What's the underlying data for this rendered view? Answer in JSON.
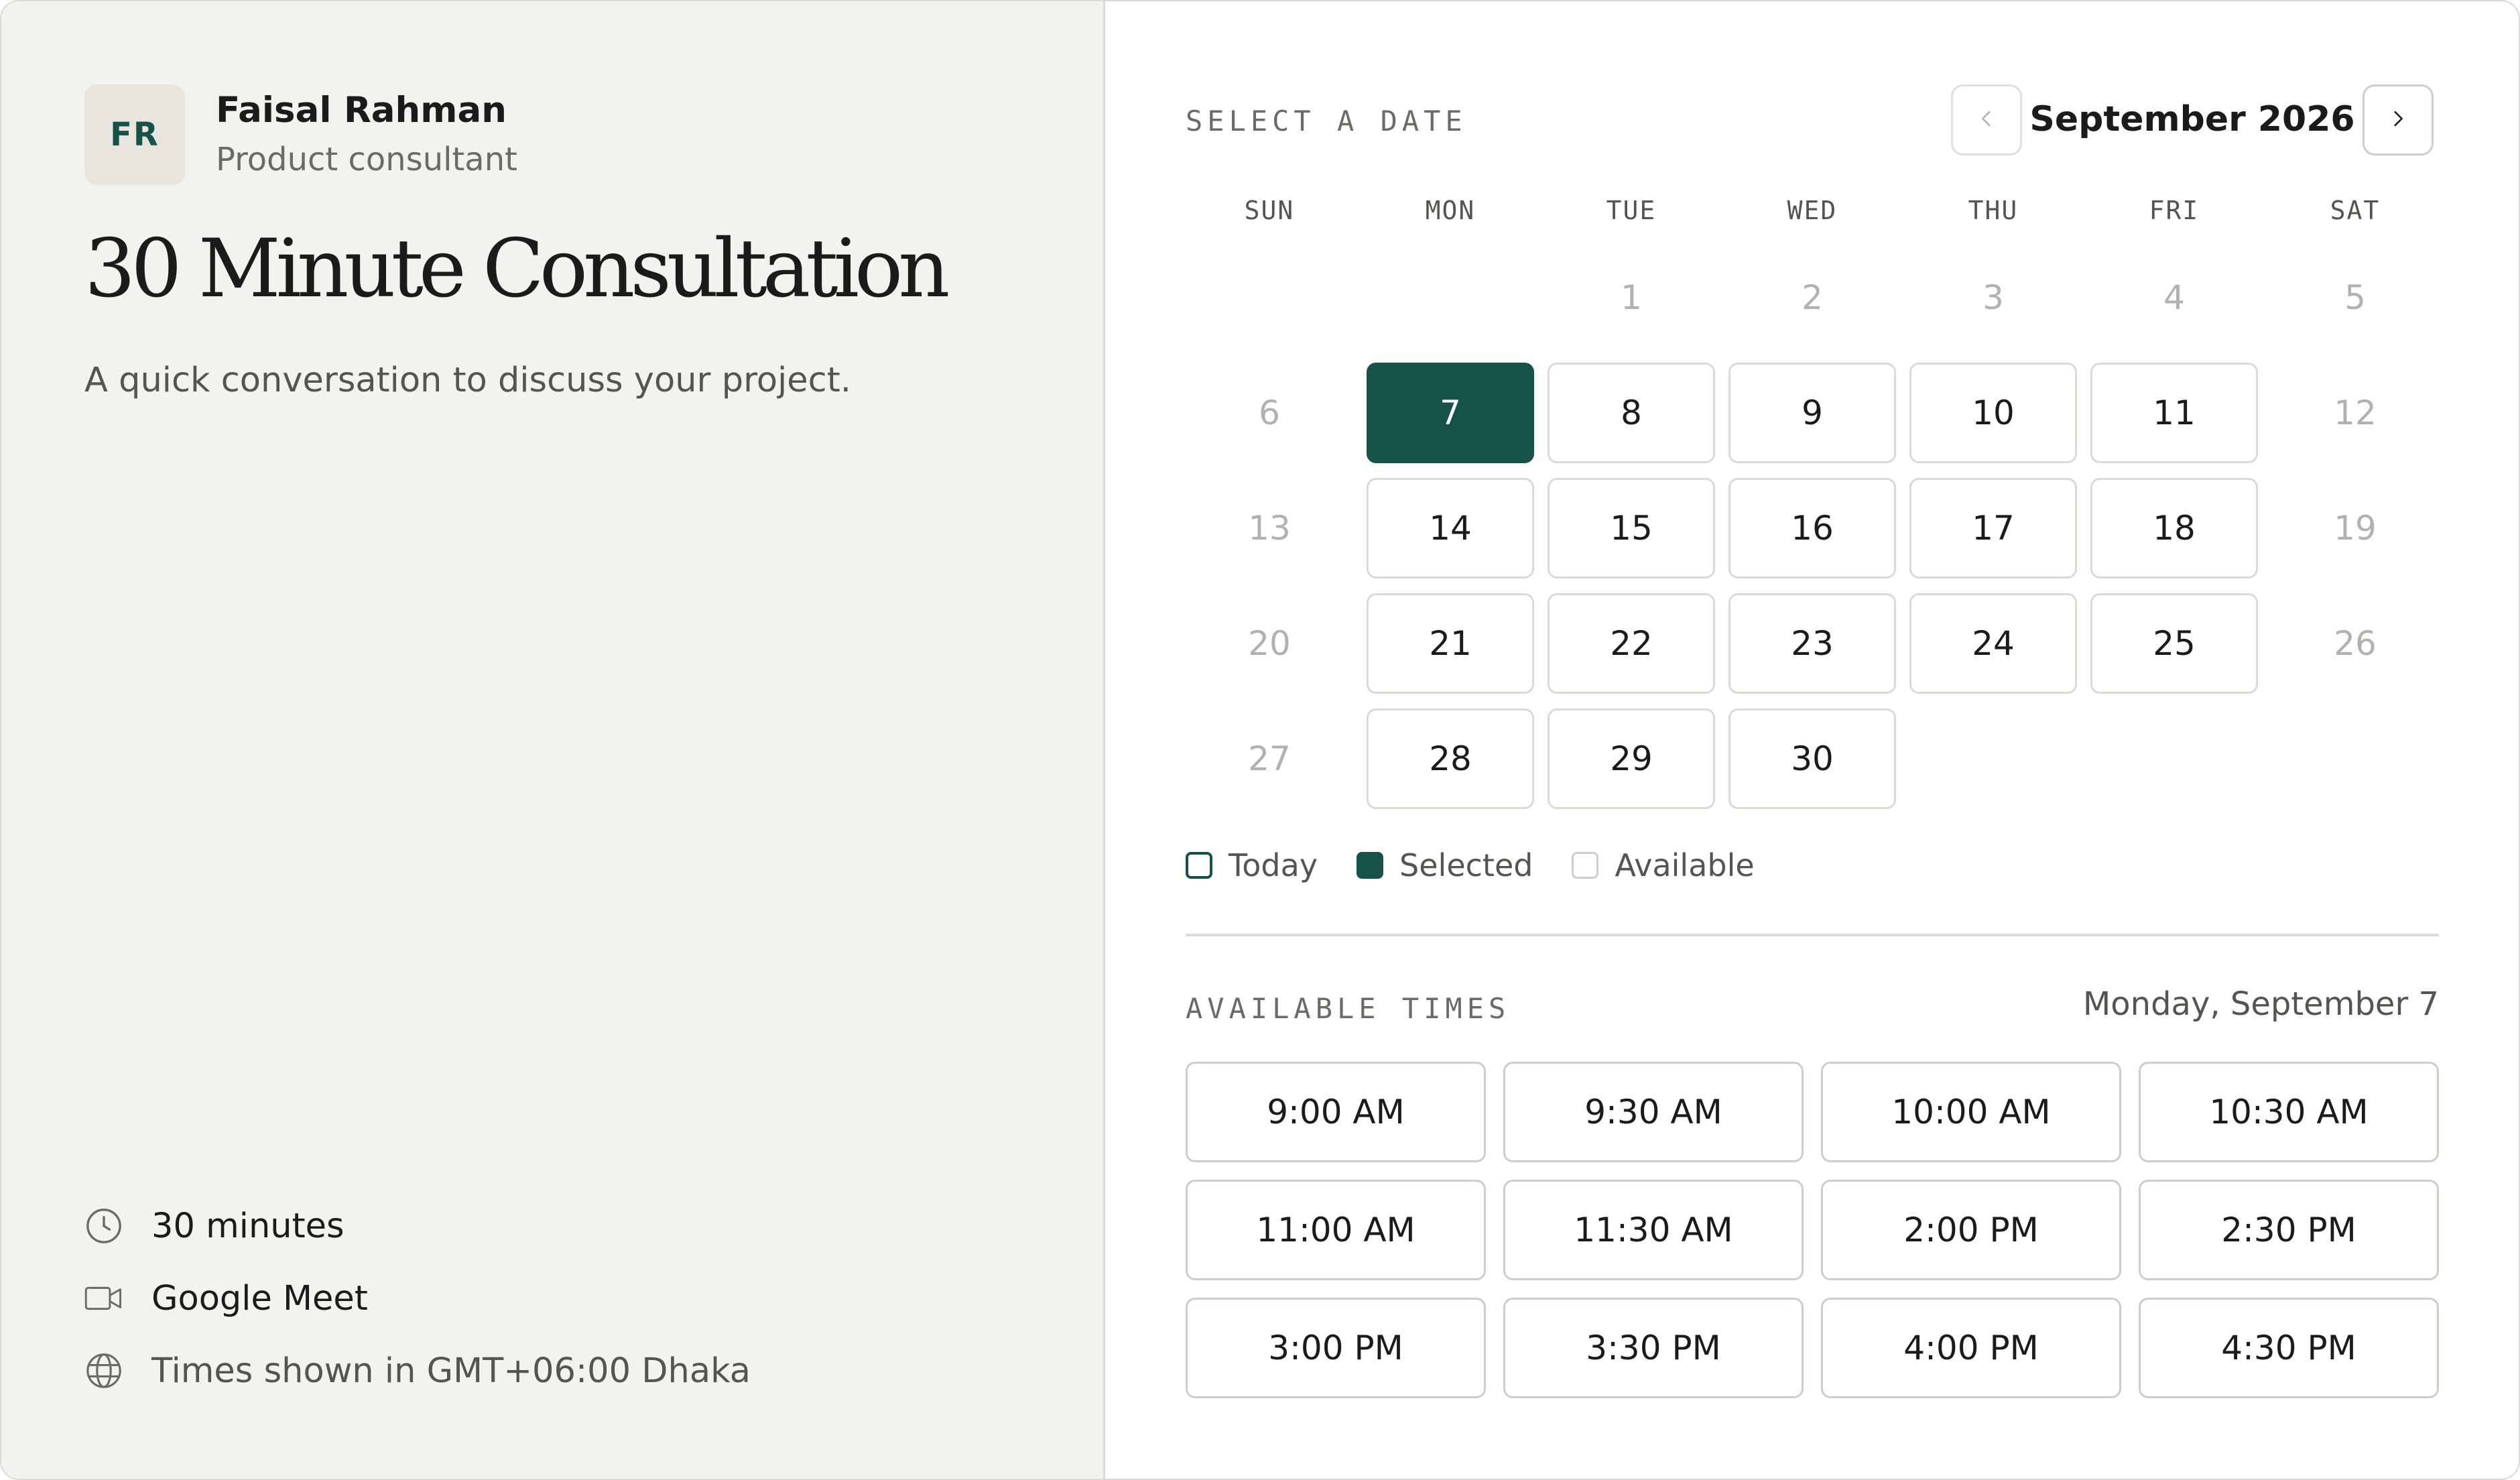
{
  "host": {
    "initials": "FR",
    "name": "Faisal Rahman",
    "role": "Product consultant"
  },
  "event": {
    "title": "30 Minute Consultation",
    "description": "A quick conversation to discuss your project."
  },
  "meta": {
    "duration": "30 minutes",
    "platform": "Google Meet",
    "timezone": "Times shown in GMT+06:00 Dhaka"
  },
  "calendar": {
    "section_label": "SELECT A DATE",
    "month": "September 2026",
    "prev_icon": "chevron-left-icon",
    "next_icon": "chevron-right-icon",
    "weekdays": [
      "SUN",
      "MON",
      "TUE",
      "WED",
      "THU",
      "FRI",
      "SAT"
    ],
    "days": [
      {
        "day": "1",
        "state": "unavailable"
      },
      {
        "day": "2",
        "state": "unavailable"
      },
      {
        "day": "3",
        "state": "unavailable"
      },
      {
        "day": "4",
        "state": "unavailable"
      },
      {
        "day": "5",
        "state": "unavailable"
      },
      {
        "day": "6",
        "state": "unavailable"
      },
      {
        "day": "7",
        "state": "selected"
      },
      {
        "day": "8",
        "state": "available"
      },
      {
        "day": "9",
        "state": "available"
      },
      {
        "day": "10",
        "state": "available"
      },
      {
        "day": "11",
        "state": "available"
      },
      {
        "day": "12",
        "state": "unavailable"
      },
      {
        "day": "13",
        "state": "unavailable"
      },
      {
        "day": "14",
        "state": "available"
      },
      {
        "day": "15",
        "state": "available"
      },
      {
        "day": "16",
        "state": "available"
      },
      {
        "day": "17",
        "state": "available"
      },
      {
        "day": "18",
        "state": "available"
      },
      {
        "day": "19",
        "state": "unavailable"
      },
      {
        "day": "20",
        "state": "unavailable"
      },
      {
        "day": "21",
        "state": "available"
      },
      {
        "day": "22",
        "state": "available"
      },
      {
        "day": "23",
        "state": "available"
      },
      {
        "day": "24",
        "state": "available"
      },
      {
        "day": "25",
        "state": "available"
      },
      {
        "day": "26",
        "state": "unavailable"
      },
      {
        "day": "27",
        "state": "unavailable"
      },
      {
        "day": "28",
        "state": "available"
      },
      {
        "day": "29",
        "state": "available"
      },
      {
        "day": "30",
        "state": "available"
      }
    ],
    "legend": {
      "today": "Today",
      "selected": "Selected",
      "available": "Available"
    }
  },
  "times": {
    "section_label": "AVAILABLE TIMES",
    "selected_date": "Monday, September 7",
    "slots": [
      "9:00 AM",
      "9:30 AM",
      "10:00 AM",
      "10:30 AM",
      "11:00 AM",
      "11:30 AM",
      "2:00 PM",
      "2:30 PM",
      "3:00 PM",
      "3:30 PM",
      "4:00 PM",
      "4:30 PM"
    ]
  },
  "colors": {
    "accent": "#17524a",
    "left_panel_bg": "#f3f2ed",
    "border": "#dcdad3"
  }
}
